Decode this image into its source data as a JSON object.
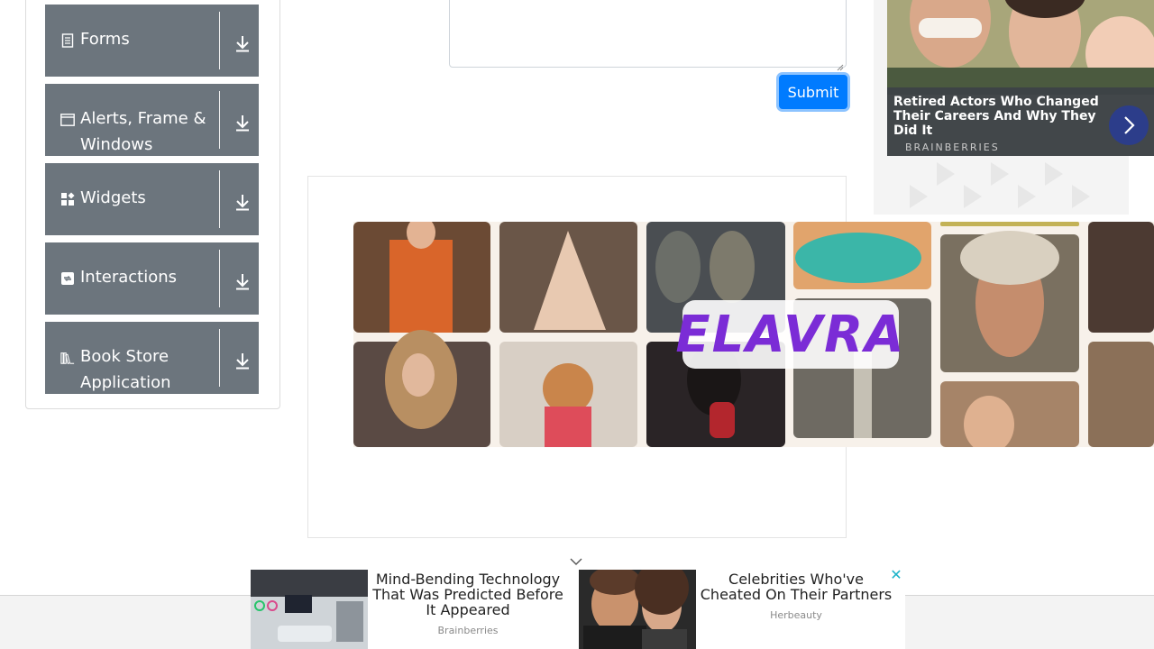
{
  "sidebar": {
    "groups": [
      {
        "label": "Forms",
        "icon": "document-icon"
      },
      {
        "label": "Alerts, Frame &",
        "label2": "Windows",
        "icon": "window-icon"
      },
      {
        "label": "Widgets",
        "icon": "widgets-icon"
      },
      {
        "label": "Interactions",
        "icon": "interactions-icon"
      },
      {
        "label": "Book Store",
        "label2": "Application",
        "icon": "books-icon"
      }
    ]
  },
  "form": {
    "submit_label": "Submit"
  },
  "banner_ad": {
    "brand": "ELAVRA"
  },
  "right_ad": {
    "title": "Retired Actors Who Changed Their Careers And Why They Did It",
    "source": "BRAINBERRIES"
  },
  "bottom_ad": {
    "cards": [
      {
        "title": "Mind-Bending Technology That Was Predicted Before It Appeared",
        "source": "Brainberries"
      },
      {
        "title": "Celebrities Who've Cheated On Their Partners",
        "source": "Herbeauty"
      }
    ],
    "close": "✕"
  },
  "colors": {
    "menu_bg": "#6c757d",
    "primary": "#007bff",
    "brand_purple": "#7b2cd6"
  }
}
